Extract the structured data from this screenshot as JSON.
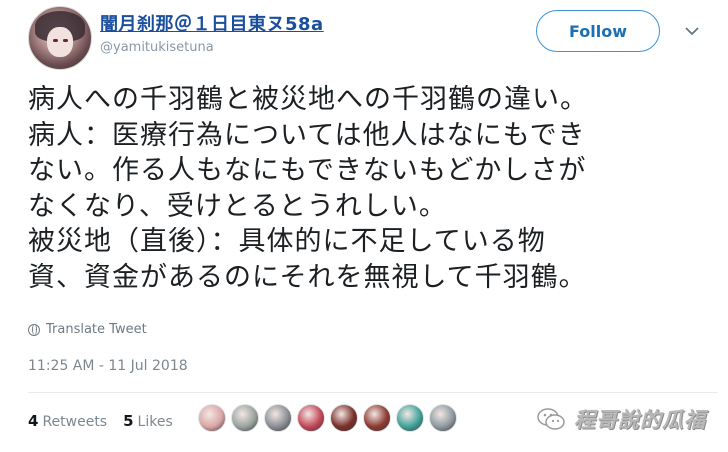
{
  "user": {
    "display_name": "闇月刹那＠１日目東ヌ58a",
    "handle": "@yamitukisetuna"
  },
  "follow_label": "Follow",
  "tweet_text": "病人への千羽鶴と被災地への千羽鶴の違い。\n病人：医療行為については他人はなにもでき\nない。作る人もなにもできないもどかしさが\nなくなり、受けとるとうれしい。\n被災地（直後）：具体的に不足している物\n資、資金があるのにそれを無視して千羽鶴。",
  "translate_label": "Translate Tweet",
  "timestamp": "11:25 AM - 11 Jul 2018",
  "stats": {
    "retweets_count": "4",
    "retweets_label": "Retweets",
    "likes_count": "5",
    "likes_label": "Likes"
  },
  "liker_avatars": [
    "#d9a6a6",
    "#9aa3a0",
    "#8a8e94",
    "#c24656",
    "#7a2f2a",
    "#8b3b32",
    "#3fa39a",
    "#8e9aa0"
  ],
  "watermark_text": "程哥說的瓜福",
  "colors": {
    "name_link": "#1b4f9c",
    "follow_border": "#3b94d9",
    "muted": "#7d8790"
  }
}
